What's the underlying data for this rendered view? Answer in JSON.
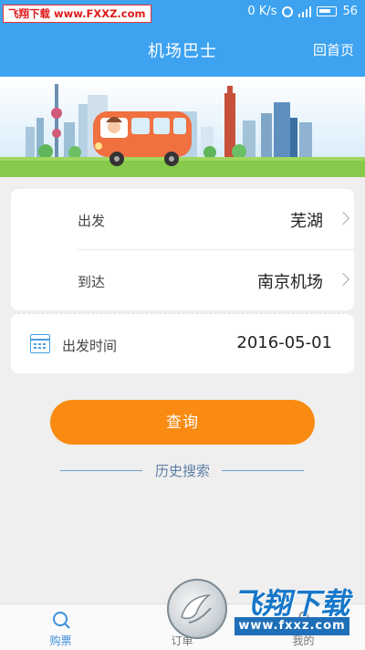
{
  "status_bar": {
    "watermark_text": "飞翔下载 www.FXXZ.com",
    "speed": "0 K/s",
    "battery_level": "56"
  },
  "header": {
    "title": "机场巴士",
    "home_label": "回首页"
  },
  "form": {
    "depart_label": "出发",
    "depart_value": "芜湖",
    "arrive_label": "到达",
    "arrive_value": "南京机场",
    "date_label": "出发时间",
    "date_value": "2016-05-01"
  },
  "search_label": "查询",
  "history_label": "历史搜索",
  "tabs": [
    {
      "label": "购票",
      "icon": "search-icon",
      "active": true
    },
    {
      "label": "订单",
      "icon": "order-icon",
      "active": false
    },
    {
      "label": "我的",
      "icon": "user-icon",
      "active": false
    }
  ],
  "watermark": {
    "title": "飞翔下载",
    "url": "www.fxxz.com"
  },
  "colors": {
    "brand_blue": "#3da2f0",
    "button_orange": "#f98b12",
    "active_tab": "#3d8fd9"
  }
}
